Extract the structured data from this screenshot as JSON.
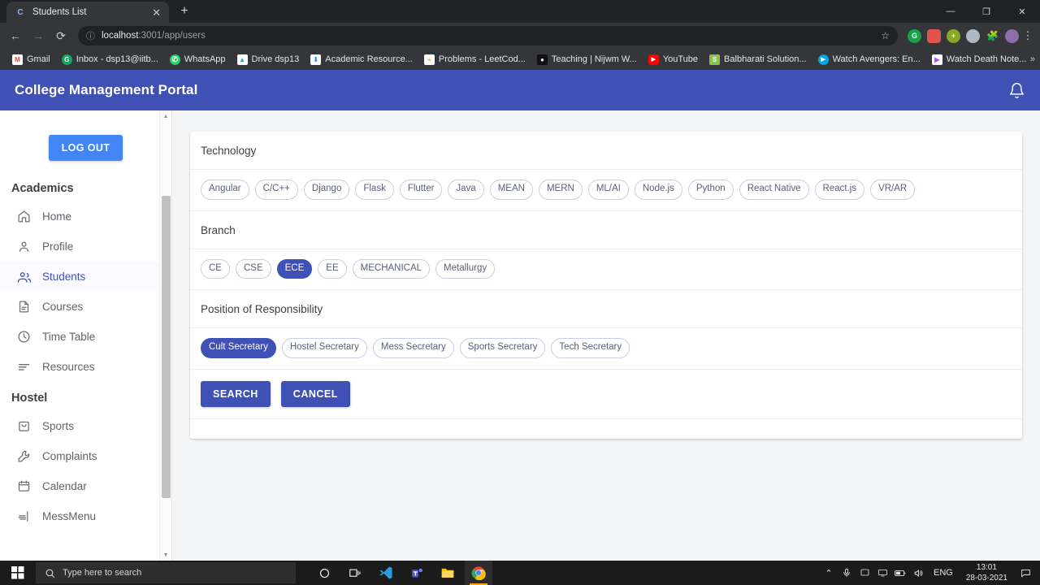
{
  "browser": {
    "tab": {
      "title": "Students List",
      "favicon_letter": "C",
      "close_icon": "✕"
    },
    "newtab_label": "+",
    "window_controls": {
      "minimize": "—",
      "maximize": "❐",
      "close": "✕"
    },
    "nav": {
      "back": "←",
      "forward": "→",
      "reload": "⟳"
    },
    "omnibox": {
      "info_icon": "ⓘ",
      "url_host": "localhost",
      "url_path": ":3001/app/users",
      "star_icon": "☆"
    },
    "extensions": [
      {
        "name": "grammarly-extension",
        "letter": "G",
        "color": "#16a34a"
      },
      {
        "name": "red-extension",
        "letter": "",
        "color": "#e2524a"
      },
      {
        "name": "green-add-extension",
        "letter": "+",
        "color": "#8aa626"
      },
      {
        "name": "blue-extension",
        "letter": "",
        "color": "#aeb7c2"
      },
      {
        "name": "puzzle-extensions-icon",
        "letter": "🧩",
        "color": "#3c4043"
      },
      {
        "name": "profile-avatar",
        "letter": "",
        "color": "#7a6ea0"
      }
    ],
    "menu_icon": "⋮",
    "bookmarks": [
      {
        "label": "Gmail",
        "ico": "M",
        "color": "#ffffff",
        "fg": "#ea4335"
      },
      {
        "label": "Inbox - dsp13@iitb...",
        "ico": "G",
        "color": "#1aa463",
        "fg": "#ffffff"
      },
      {
        "label": "WhatsApp",
        "ico": "✆",
        "color": "#25d366",
        "fg": "#ffffff"
      },
      {
        "label": "Drive dsp13",
        "ico": "▲",
        "color": "#ffffff",
        "fg": "#2196f3"
      },
      {
        "label": "Academic Resource...",
        "ico": "⬇",
        "color": "#ffffff",
        "fg": "#4285f4"
      },
      {
        "label": "Problems - LeetCod...",
        "ico": "⌁",
        "color": "#ffffff",
        "fg": "#ffa116"
      },
      {
        "label": "Teaching | Nijwm W...",
        "ico": "●",
        "color": "#111111",
        "fg": "#ffffff"
      },
      {
        "label": "YouTube",
        "ico": "▶",
        "color": "#ff0000",
        "fg": "#ffffff"
      },
      {
        "label": "Balbharati Solution...",
        "ico": "S",
        "color": "#8bc34a",
        "fg": "#ffffff"
      },
      {
        "label": "Watch Avengers: En...",
        "ico": "▶",
        "color": "#00a8e1",
        "fg": "#ffffff"
      },
      {
        "label": "Watch Death Note...",
        "ico": "▶",
        "color": "#ffffff",
        "fg": "#b14bf4"
      }
    ],
    "bookmarks_overflow": "»"
  },
  "app": {
    "header": {
      "title": "College Management Portal",
      "bell_icon": "notification-bell"
    },
    "sidebar": {
      "logout_label": "LOG OUT",
      "groups": [
        {
          "title": "Academics",
          "items": [
            {
              "label": "Home",
              "icon": "home-icon",
              "active": false
            },
            {
              "label": "Profile",
              "icon": "user-icon",
              "active": false
            },
            {
              "label": "Students",
              "icon": "users-icon",
              "active": true
            },
            {
              "label": "Courses",
              "icon": "document-icon",
              "active": false
            },
            {
              "label": "Time Table",
              "icon": "clock-icon",
              "active": false
            },
            {
              "label": "Resources",
              "icon": "list-icon",
              "active": false
            }
          ]
        },
        {
          "title": "Hostel",
          "items": [
            {
              "label": "Sports",
              "icon": "bag-icon",
              "active": false
            },
            {
              "label": "Complaints",
              "icon": "wrench-icon",
              "active": false
            },
            {
              "label": "Calendar",
              "icon": "calendar-icon",
              "active": false
            },
            {
              "label": "MessMenu",
              "icon": "food-icon",
              "active": false
            }
          ]
        }
      ],
      "scroll_up_icon": "▲",
      "scroll_down_icon": "▼"
    },
    "filter_card": {
      "sections": [
        {
          "label": "Technology",
          "chips": [
            {
              "label": "Angular",
              "selected": false
            },
            {
              "label": "C/C++",
              "selected": false
            },
            {
              "label": "Django",
              "selected": false
            },
            {
              "label": "Flask",
              "selected": false
            },
            {
              "label": "Flutter",
              "selected": false
            },
            {
              "label": "Java",
              "selected": false
            },
            {
              "label": "MEAN",
              "selected": false
            },
            {
              "label": "MERN",
              "selected": false
            },
            {
              "label": "ML/AI",
              "selected": false
            },
            {
              "label": "Node.js",
              "selected": false
            },
            {
              "label": "Python",
              "selected": false
            },
            {
              "label": "React Native",
              "selected": false
            },
            {
              "label": "React.js",
              "selected": false
            },
            {
              "label": "VR/AR",
              "selected": false
            }
          ]
        },
        {
          "label": "Branch",
          "chips": [
            {
              "label": "CE",
              "selected": false
            },
            {
              "label": "CSE",
              "selected": false
            },
            {
              "label": "ECE",
              "selected": true
            },
            {
              "label": "EE",
              "selected": false
            },
            {
              "label": "MECHANICAL",
              "selected": false
            },
            {
              "label": "Metallurgy",
              "selected": false
            }
          ]
        },
        {
          "label": "Position of Responsibility",
          "chips": [
            {
              "label": "Cult Secretary",
              "selected": true
            },
            {
              "label": "Hostel Secretary",
              "selected": false
            },
            {
              "label": "Mess Secretary",
              "selected": false
            },
            {
              "label": "Sports Secretary",
              "selected": false
            },
            {
              "label": "Tech Secretary",
              "selected": false
            }
          ]
        }
      ],
      "actions": [
        {
          "label": "SEARCH",
          "name": "search-button"
        },
        {
          "label": "CANCEL",
          "name": "cancel-button"
        }
      ]
    },
    "colors": {
      "primary": "#3f51b5",
      "logout": "#4285f4",
      "chip_border": "#c9cde6",
      "page_bg": "#f4f5f7"
    }
  },
  "taskbar": {
    "start_icon": "windows-logo",
    "search_placeholder": "Type here to search",
    "apps": [
      {
        "name": "cortana-icon",
        "glyph": "◯",
        "active": false
      },
      {
        "name": "task-view-icon",
        "glyph": "❏|",
        "active": false
      },
      {
        "name": "vscode-icon",
        "glyph": "X",
        "active": false
      },
      {
        "name": "teams-icon",
        "glyph": "T",
        "active": false
      },
      {
        "name": "file-explorer-icon",
        "glyph": "🗀",
        "active": false
      },
      {
        "name": "chrome-icon",
        "glyph": "◉",
        "active": true
      }
    ],
    "tray": {
      "chevron": "⌃",
      "icons": [
        "microphone-icon",
        "screen-snip-icon",
        "display-icon",
        "battery-icon",
        "volume-icon"
      ],
      "language": "ENG",
      "time": "13:01",
      "date": "28-03-2021",
      "action_center": "▢"
    }
  }
}
